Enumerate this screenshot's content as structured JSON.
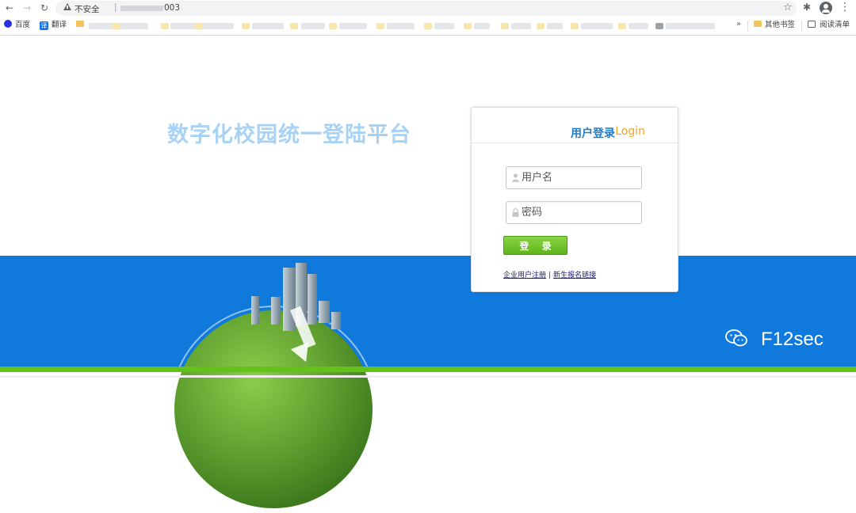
{
  "browser": {
    "insecure_label": "不安全",
    "url_separator": "|",
    "url_suffix": "003",
    "icons": [
      "back-icon",
      "forward-icon",
      "reload-icon",
      "warning-icon",
      "star-icon",
      "extensions-icon",
      "profile-icon",
      "menu-icon"
    ]
  },
  "bookmarks": {
    "baidu": "百度",
    "fanyi_icon": "译",
    "fanyi": "翻译",
    "more": "»",
    "other": "其他书签",
    "reading_list": "阅读清单"
  },
  "page": {
    "title": "数字化校园统一登陆平台"
  },
  "login": {
    "title": "用户登录",
    "title_en": "Login",
    "username_placeholder": "用户名",
    "password_placeholder": "密码",
    "submit_label": "登 录",
    "link_enterprise": "企业用户注册",
    "link_separator": "|",
    "link_newstudent": "新生报名链接"
  },
  "watermark": {
    "text": "F12sec",
    "icon": "wechat-icon"
  },
  "colors": {
    "blue_band": "#0f79dc",
    "green_strip": "#63c21a",
    "title_text": "#a6d2f6",
    "login_title": "#1f7bc9",
    "login_accent": "#f3a421",
    "button_green": "#6cc12a"
  }
}
